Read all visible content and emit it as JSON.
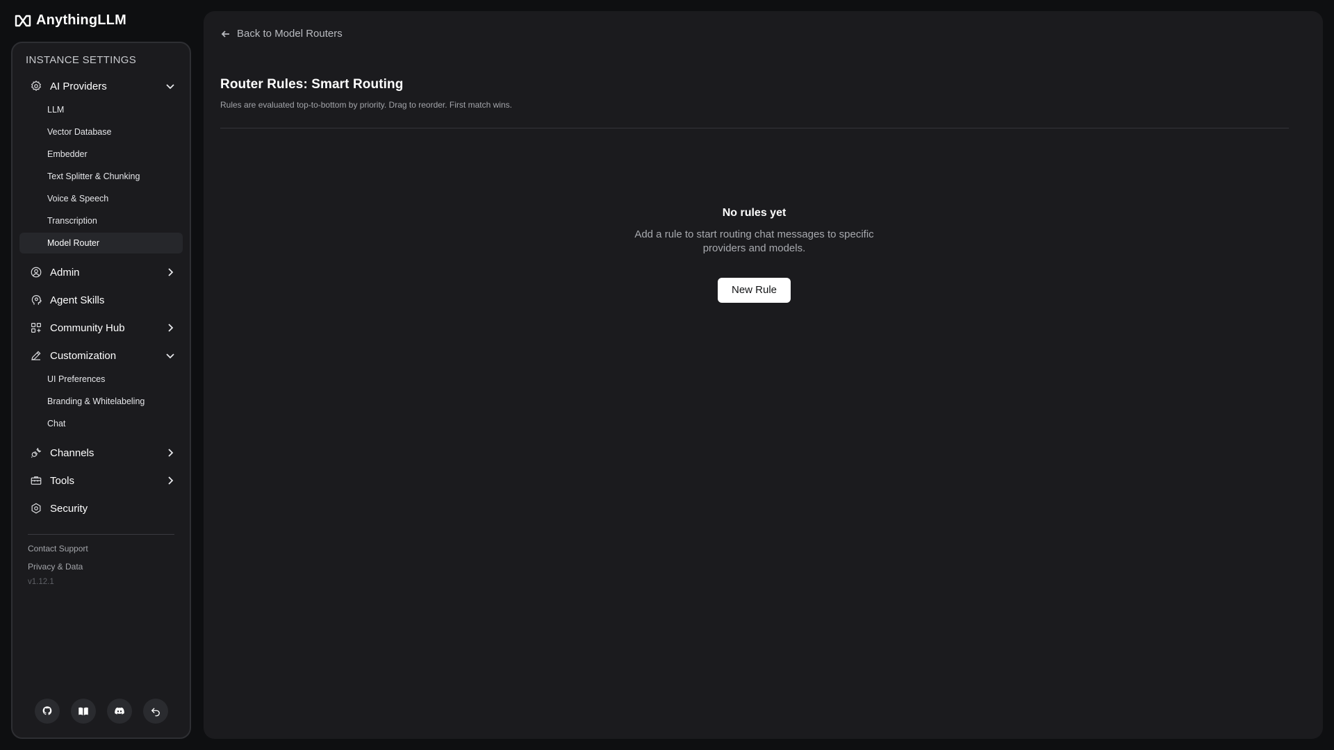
{
  "app": {
    "name": "AnythingLLM"
  },
  "sidebar": {
    "heading": "INSTANCE SETTINGS",
    "ai_providers": {
      "label": "AI Providers",
      "items": [
        "LLM",
        "Vector Database",
        "Embedder",
        "Text Splitter & Chunking",
        "Voice & Speech",
        "Transcription",
        "Model Router"
      ],
      "active": "Model Router"
    },
    "admin": {
      "label": "Admin"
    },
    "agent_skills": {
      "label": "Agent Skills"
    },
    "community_hub": {
      "label": "Community Hub"
    },
    "customization": {
      "label": "Customization",
      "items": [
        "UI Preferences",
        "Branding & Whitelabeling",
        "Chat"
      ]
    },
    "channels": {
      "label": "Channels"
    },
    "tools": {
      "label": "Tools"
    },
    "security": {
      "label": "Security"
    },
    "footer": {
      "contact_support": "Contact Support",
      "privacy": "Privacy & Data",
      "version": "v1.12.1"
    }
  },
  "main": {
    "back_label": "Back to Model Routers",
    "title": "Router Rules: Smart Routing",
    "description": "Rules are evaluated top-to-bottom by priority. Drag to reorder. First match wins.",
    "empty_state": {
      "title": "No rules yet",
      "text": "Add a rule to start routing chat messages to specific providers and models.",
      "button": "New Rule"
    }
  }
}
